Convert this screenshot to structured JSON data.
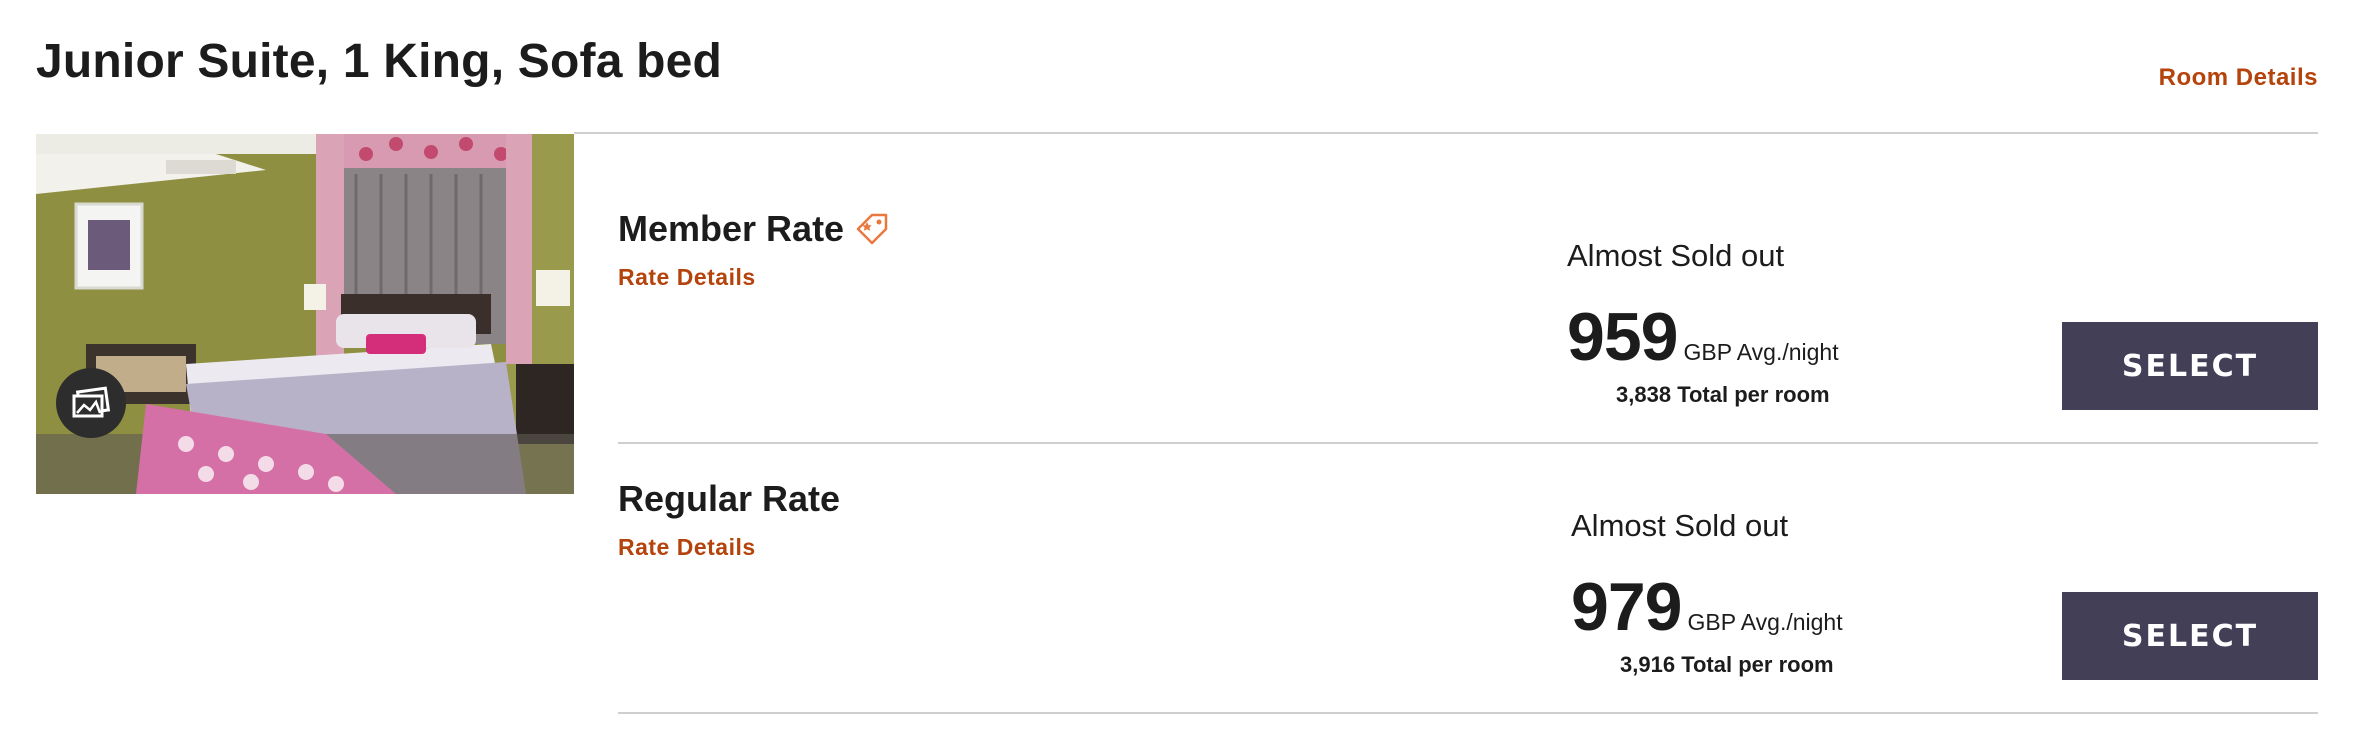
{
  "room": {
    "title": "Junior Suite, 1 King, Sofa bed",
    "details_link": "Room Details",
    "photo_icon": "image-gallery-icon"
  },
  "rates": [
    {
      "name": "Member Rate",
      "name_icon": "member-tag-icon",
      "details_link": "Rate Details",
      "availability": "Almost Sold out",
      "price": "959",
      "price_unit": "GBP Avg./night",
      "total_amount": "3,838",
      "total_label": "Total per room",
      "select_label": "SELECT"
    },
    {
      "name": "Regular Rate",
      "details_link": "Rate Details",
      "availability": "Almost Sold out",
      "price": "979",
      "price_unit": "GBP Avg./night",
      "total_amount": "3,916",
      "total_label": "Total per room",
      "select_label": "SELECT"
    }
  ],
  "colors": {
    "link": "#b5430c",
    "button_bg": "#433f57",
    "tag_icon": "#e9783f",
    "divider": "#cfcfcf"
  }
}
